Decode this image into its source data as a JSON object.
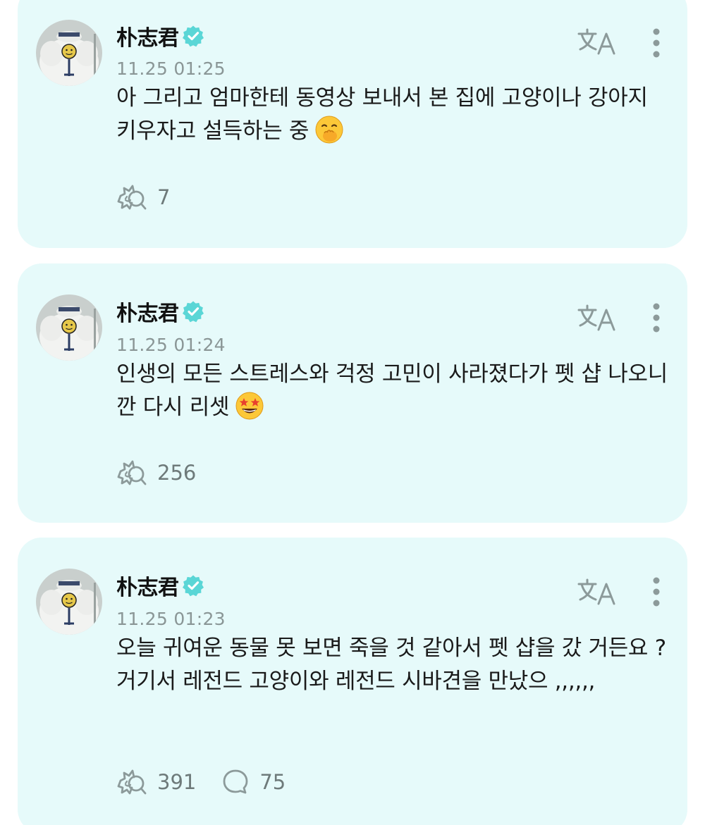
{
  "posts": [
    {
      "author": "朴志君",
      "timestamp": "11.25 01:25",
      "text": "아 그리고 엄마한테 동영상 보내서 본 집에 고양이나 강아지 키우자고 설득하는 중",
      "emoji": "face-with-hand-over-mouth",
      "stats": {
        "likes": "7"
      }
    },
    {
      "author": "朴志君",
      "timestamp": "11.25 01:24",
      "text": "인생의 모든 스트레스와 걱정 고민이 사라졌다가 펫 샵 나오니깐 다시 리셋",
      "emoji": "star-struck-face",
      "stats": {
        "likes": "256"
      }
    },
    {
      "author": "朴志君",
      "timestamp": "11.25 01:23",
      "text": "오늘 귀여운 동물 못 보면 죽을 것 같아서 펫 샵을 갔 거든요 ? 거기서 레전드 고양이와 레전드 시바견을 만났으 ,,,,,,",
      "emoji": "",
      "stats": {
        "likes": "391",
        "comments": "75"
      }
    }
  ],
  "colors": {
    "card_background": "#e6fafa",
    "verified_badge": "#5ad6d6",
    "icon_gray": "#8c9a9a",
    "timestamp": "#8a9696"
  }
}
